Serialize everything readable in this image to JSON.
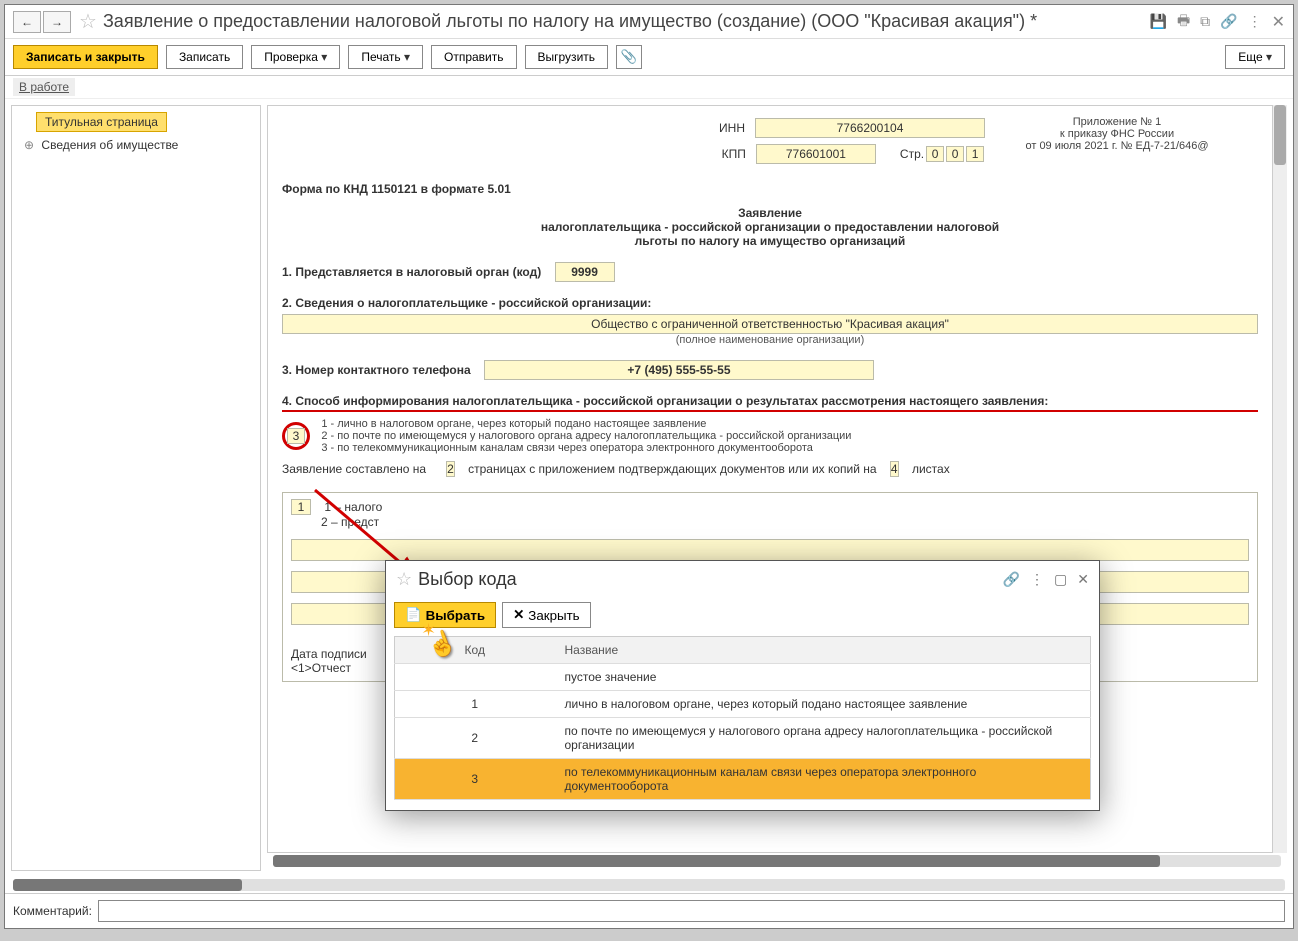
{
  "title": "Заявление о предоставлении налоговой льготы по налогу на имущество (создание) (ООО \"Красивая акация\") *",
  "toolbar": {
    "save_close": "Записать и закрыть",
    "save": "Записать",
    "check": "Проверка",
    "print": "Печать",
    "send": "Отправить",
    "export": "Выгрузить",
    "more": "Еще"
  },
  "status": "В работе",
  "nav": {
    "title_page": "Титульная страница",
    "prop_info": "Сведения об имуществе"
  },
  "form": {
    "inn_label": "ИНН",
    "inn": "7766200104",
    "kpp_label": "КПП",
    "kpp": "776601001",
    "page_label": "Стр.",
    "page_d1": "0",
    "page_d2": "0",
    "page_d3": "1",
    "appendix_l1": "Приложение № 1",
    "appendix_l2": "к приказу ФНС России",
    "appendix_l3": "от 09 июля 2021 г. № ЕД-7-21/646@",
    "knd": "Форма по КНД 1150121 в формате 5.01",
    "head1": "Заявление",
    "head2": "налогоплательщика - российской организации о предоставлении налоговой",
    "head3": "льготы по налогу на имущество организаций",
    "sec1": "1. Представляется в налоговый орган (код)",
    "tax_code": "9999",
    "sec2": "2. Сведения о налогоплательщике - российской организации:",
    "org_name": "Общество с ограниченной ответственностью \"Красивая акация\"",
    "org_hint": "(полное наименование организации)",
    "sec3": "3. Номер контактного телефона",
    "phone": "+7 (495) 555-55-55",
    "sec4": "4. Способ информирования налогоплательщика - российской организации о результатах рассмотрения настоящего заявления:",
    "way_code": "3",
    "opt1": "1 - лично в налоговом органе, через который подано настоящее заявление",
    "opt2": "2 - по почте по имеющемуся у налогового органа адресу налогоплательщика - российской организации",
    "opt3": "3 - по телекоммуникационным каналам связи через оператора электронного документооборота",
    "pages_l1": "Заявление составлено на",
    "pages_v": "2",
    "pages_l2": "страницах с приложением подтверждающих документов или их копий на",
    "attach_v": "4",
    "pages_l3": "листах",
    "below_sel": "1",
    "below_o1": "1 – налого",
    "below_o2": "2 – предст",
    "sign_l1": "Дата подписи",
    "sign_l2": "<1>Отчест"
  },
  "dialog": {
    "title": "Выбор кода",
    "select": "Выбрать",
    "close": "Закрыть",
    "col_code": "Код",
    "col_name": "Название",
    "rows": [
      {
        "code": "",
        "name": "пустое значение"
      },
      {
        "code": "1",
        "name": "лично в налоговом органе, через который подано настоящее заявление"
      },
      {
        "code": "2",
        "name": "по почте по имеющемуся у налогового органа адресу налогоплательщика - российской организации"
      },
      {
        "code": "3",
        "name": "по телекоммуникационным каналам связи через оператора электронного документооборота"
      }
    ]
  },
  "footer": {
    "comment_label": "Комментарий:"
  }
}
